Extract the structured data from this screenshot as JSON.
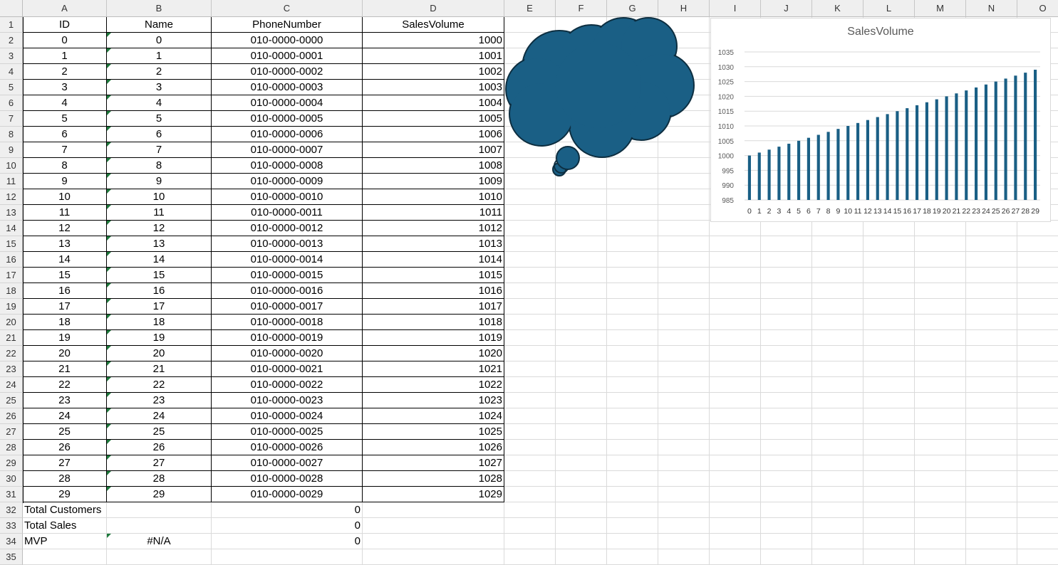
{
  "app": "spreadsheet",
  "columns": [
    "A",
    "B",
    "C",
    "D",
    "E",
    "F",
    "G",
    "H",
    "I",
    "J",
    "K",
    "L",
    "M",
    "N",
    "O"
  ],
  "row_numbers": [
    "1",
    "2",
    "3",
    "4",
    "5",
    "6",
    "7",
    "8",
    "9",
    "10",
    "11",
    "12",
    "13",
    "14",
    "15",
    "16",
    "17",
    "18",
    "19",
    "20",
    "21",
    "22",
    "23",
    "24",
    "25",
    "26",
    "27",
    "28",
    "29",
    "30",
    "31",
    "32",
    "33",
    "34",
    "35"
  ],
  "headers": [
    "ID",
    "Name",
    "PhoneNumber",
    "SalesVolume"
  ],
  "rows": [
    [
      "0",
      "0",
      "010-0000-0000",
      "1000"
    ],
    [
      "1",
      "1",
      "010-0000-0001",
      "1001"
    ],
    [
      "2",
      "2",
      "010-0000-0002",
      "1002"
    ],
    [
      "3",
      "3",
      "010-0000-0003",
      "1003"
    ],
    [
      "4",
      "4",
      "010-0000-0004",
      "1004"
    ],
    [
      "5",
      "5",
      "010-0000-0005",
      "1005"
    ],
    [
      "6",
      "6",
      "010-0000-0006",
      "1006"
    ],
    [
      "7",
      "7",
      "010-0000-0007",
      "1007"
    ],
    [
      "8",
      "8",
      "010-0000-0008",
      "1008"
    ],
    [
      "9",
      "9",
      "010-0000-0009",
      "1009"
    ],
    [
      "10",
      "10",
      "010-0000-0010",
      "1010"
    ],
    [
      "11",
      "11",
      "010-0000-0011",
      "1011"
    ],
    [
      "12",
      "12",
      "010-0000-0012",
      "1012"
    ],
    [
      "13",
      "13",
      "010-0000-0013",
      "1013"
    ],
    [
      "14",
      "14",
      "010-0000-0014",
      "1014"
    ],
    [
      "15",
      "15",
      "010-0000-0015",
      "1015"
    ],
    [
      "16",
      "16",
      "010-0000-0016",
      "1016"
    ],
    [
      "17",
      "17",
      "010-0000-0017",
      "1017"
    ],
    [
      "18",
      "18",
      "010-0000-0018",
      "1018"
    ],
    [
      "19",
      "19",
      "010-0000-0019",
      "1019"
    ],
    [
      "20",
      "20",
      "010-0000-0020",
      "1020"
    ],
    [
      "21",
      "21",
      "010-0000-0021",
      "1021"
    ],
    [
      "22",
      "22",
      "010-0000-0022",
      "1022"
    ],
    [
      "23",
      "23",
      "010-0000-0023",
      "1023"
    ],
    [
      "24",
      "24",
      "010-0000-0024",
      "1024"
    ],
    [
      "25",
      "25",
      "010-0000-0025",
      "1025"
    ],
    [
      "26",
      "26",
      "010-0000-0026",
      "1026"
    ],
    [
      "27",
      "27",
      "010-0000-0027",
      "1027"
    ],
    [
      "28",
      "28",
      "010-0000-0028",
      "1028"
    ],
    [
      "29",
      "29",
      "010-0000-0029",
      "1029"
    ]
  ],
  "summary": [
    {
      "label": "Total Customers",
      "b": "",
      "value": "0"
    },
    {
      "label": "Total Sales",
      "b": "",
      "value": "0"
    },
    {
      "label": "MVP",
      "b": "#N/A",
      "value": "0"
    }
  ],
  "colors": {
    "shape_fill": "#1a5f85",
    "bar_fill": "#1a5f85",
    "comment_marker": "#1e7a3c"
  },
  "chart_data": {
    "type": "bar",
    "title": "SalesVolume",
    "categories": [
      "0",
      "1",
      "2",
      "3",
      "4",
      "5",
      "6",
      "7",
      "8",
      "9",
      "10",
      "11",
      "12",
      "13",
      "14",
      "15",
      "16",
      "17",
      "18",
      "19",
      "20",
      "21",
      "22",
      "23",
      "24",
      "25",
      "26",
      "27",
      "28",
      "29"
    ],
    "values": [
      1000,
      1001,
      1002,
      1003,
      1004,
      1005,
      1006,
      1007,
      1008,
      1009,
      1010,
      1011,
      1012,
      1013,
      1014,
      1015,
      1016,
      1017,
      1018,
      1019,
      1020,
      1021,
      1022,
      1023,
      1024,
      1025,
      1026,
      1027,
      1028,
      1029
    ],
    "ylim": [
      985,
      1035
    ],
    "yticks": [
      985,
      990,
      995,
      1000,
      1005,
      1010,
      1015,
      1020,
      1025,
      1030,
      1035
    ],
    "grid": true,
    "legend": "none"
  }
}
